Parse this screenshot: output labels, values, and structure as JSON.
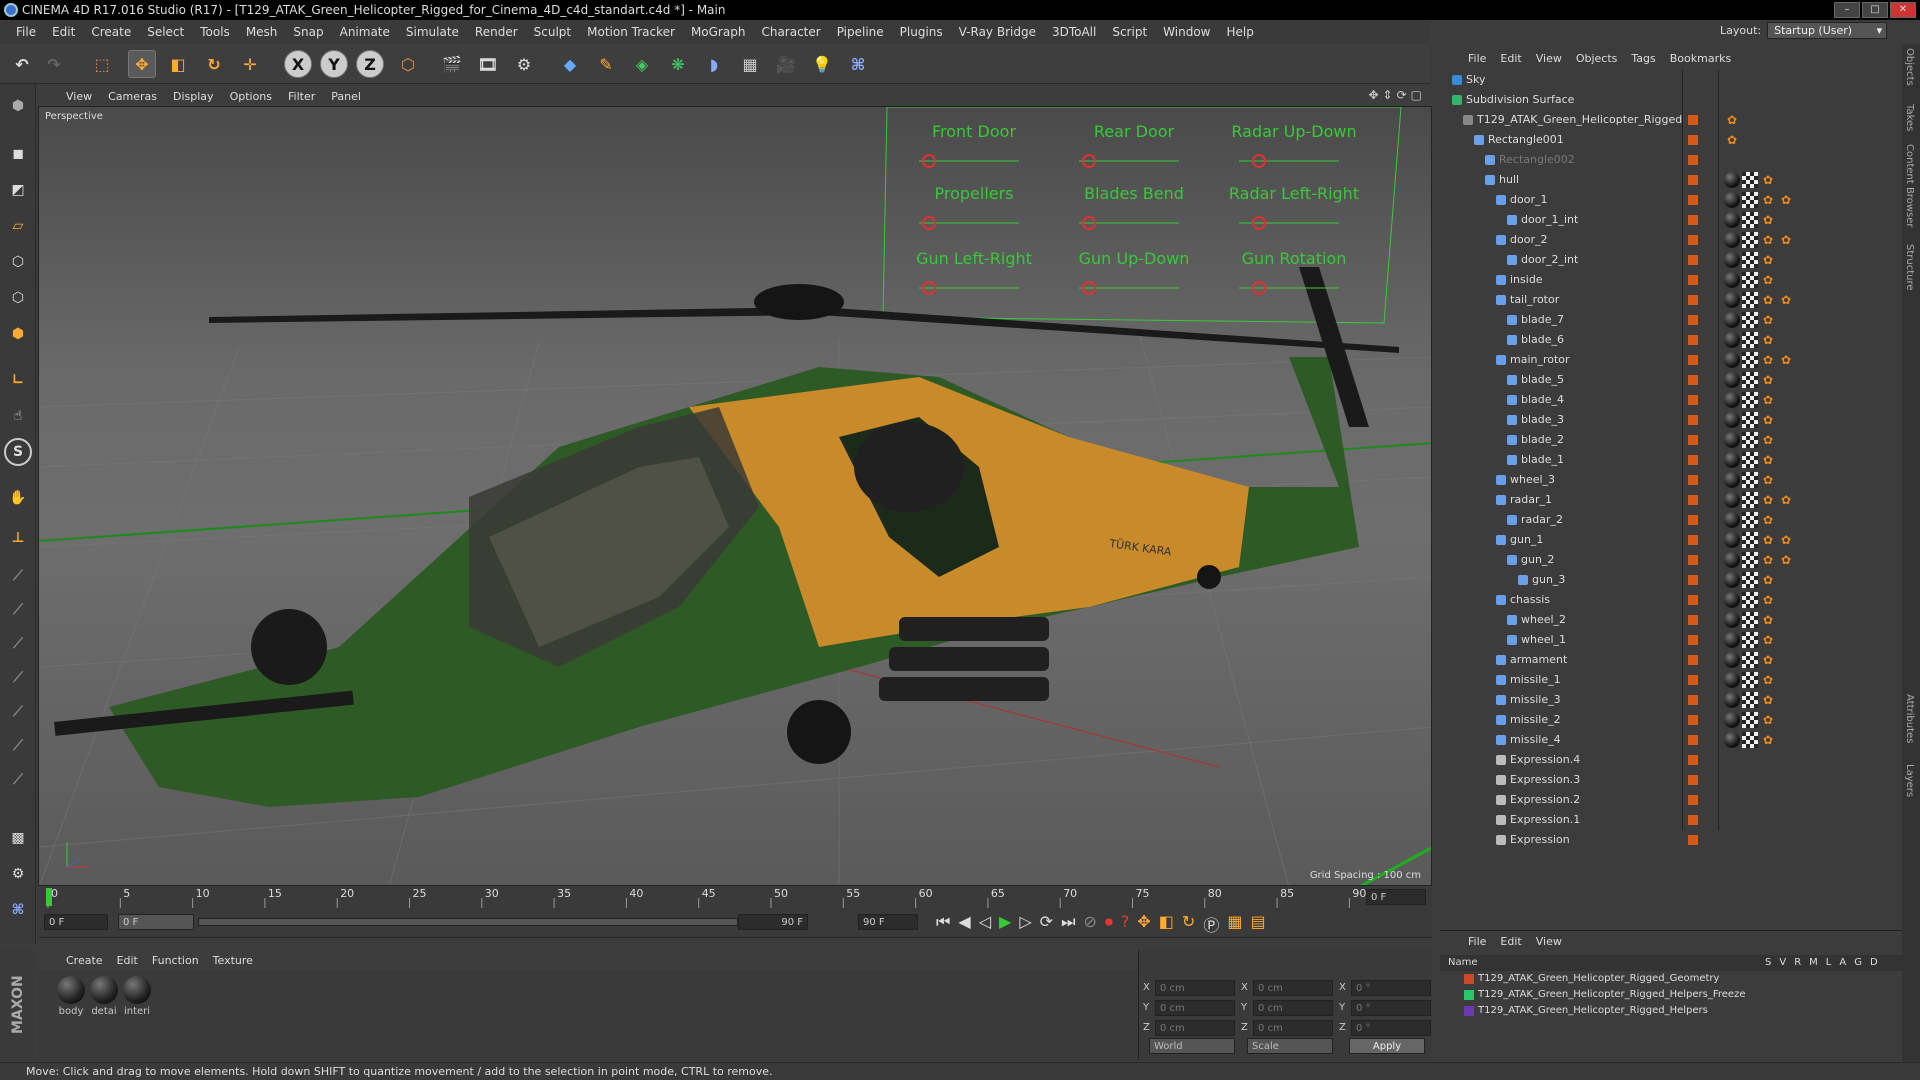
{
  "window": {
    "title": "CINEMA 4D R17.016 Studio (R17) - [T129_ATAK_Green_Helicopter_Rigged_for_Cinema_4D_c4d_standart.c4d *] - Main"
  },
  "menubar": [
    "File",
    "Edit",
    "Create",
    "Select",
    "Tools",
    "Mesh",
    "Snap",
    "Animate",
    "Simulate",
    "Render",
    "Sculpt",
    "Motion Tracker",
    "MoGraph",
    "Character",
    "Pipeline",
    "Plugins",
    "V-Ray Bridge",
    "3DToAll",
    "Script",
    "Window",
    "Help"
  ],
  "layout": {
    "label": "Layout:",
    "value": "Startup (User)"
  },
  "toolbar": {
    "axis_x": "X",
    "axis_y": "Y",
    "axis_z": "Z"
  },
  "viewport": {
    "menu": [
      "View",
      "Cameras",
      "Display",
      "Options",
      "Filter",
      "Panel"
    ],
    "label": "Perspective",
    "grid_spacing": "Grid Spacing : 100 cm",
    "controls": [
      "Front Door",
      "Rear Door",
      "Radar Up-Down",
      "Propellers",
      "Blades Bend",
      "Radar Left-Right",
      "Gun Left-Right",
      "Gun Up-Down",
      "Gun Rotation"
    ],
    "body_text": "TÜRK KARA"
  },
  "timeline": {
    "ticks": [
      "0",
      "5",
      "10",
      "15",
      "20",
      "25",
      "30",
      "35",
      "40",
      "45",
      "50",
      "55",
      "60",
      "65",
      "70",
      "75",
      "80",
      "85",
      "90"
    ],
    "current_frame": "0 F",
    "start_field": "0 F",
    "range_start": "0 F",
    "range_end": "90 F",
    "end_field": "90 F"
  },
  "materials": {
    "menu": [
      "Create",
      "Edit",
      "Function",
      "Texture"
    ],
    "items": [
      "body",
      "detai",
      "interi"
    ]
  },
  "coords": {
    "rows": [
      {
        "a": "X",
        "av": "0 cm",
        "b": "X",
        "bv": "0 cm",
        "c": "X",
        "cv": "0 °"
      },
      {
        "a": "Y",
        "av": "0 cm",
        "b": "Y",
        "bv": "0 cm",
        "c": "Y",
        "cv": "0 °"
      },
      {
        "a": "Z",
        "av": "0 cm",
        "b": "Z",
        "bv": "0 cm",
        "c": "Z",
        "cv": "0 °"
      }
    ],
    "mode": "World",
    "scale": "Scale",
    "apply": "Apply"
  },
  "objects": {
    "menu": [
      "File",
      "Edit",
      "View",
      "Objects",
      "Tags",
      "Bookmarks"
    ],
    "items": [
      {
        "name": "Sky",
        "indent": 0,
        "icon": "#3a8ad8",
        "tags": ""
      },
      {
        "name": "Subdivision Surface",
        "indent": 0,
        "icon": "#3ab06a",
        "tags": ""
      },
      {
        "name": "T129_ATAK_Green_Helicopter_Rigged",
        "indent": 1,
        "icon": "#888",
        "tags": "o"
      },
      {
        "name": "Rectangle001",
        "indent": 2,
        "icon": "#6aa0e8",
        "tags": "o"
      },
      {
        "name": "Rectangle002",
        "indent": 3,
        "icon": "#6aa0e8",
        "tags": ""
      },
      {
        "name": "hull",
        "indent": 3,
        "icon": "#6aa0e8",
        "tags": "bco"
      },
      {
        "name": "door_1",
        "indent": 4,
        "icon": "#6aa0e8",
        "tags": "bcoo"
      },
      {
        "name": "door_1_int",
        "indent": 5,
        "icon": "#6aa0e8",
        "tags": "bco"
      },
      {
        "name": "door_2",
        "indent": 4,
        "icon": "#6aa0e8",
        "tags": "bcoo"
      },
      {
        "name": "door_2_int",
        "indent": 5,
        "icon": "#6aa0e8",
        "tags": "bco"
      },
      {
        "name": "inside",
        "indent": 4,
        "icon": "#6aa0e8",
        "tags": "bco"
      },
      {
        "name": "tail_rotor",
        "indent": 4,
        "icon": "#6aa0e8",
        "tags": "bcoo"
      },
      {
        "name": "blade_7",
        "indent": 5,
        "icon": "#6aa0e8",
        "tags": "bco"
      },
      {
        "name": "blade_6",
        "indent": 5,
        "icon": "#6aa0e8",
        "tags": "bco"
      },
      {
        "name": "main_rotor",
        "indent": 4,
        "icon": "#6aa0e8",
        "tags": "bcoo"
      },
      {
        "name": "blade_5",
        "indent": 5,
        "icon": "#6aa0e8",
        "tags": "bco"
      },
      {
        "name": "blade_4",
        "indent": 5,
        "icon": "#6aa0e8",
        "tags": "bco"
      },
      {
        "name": "blade_3",
        "indent": 5,
        "icon": "#6aa0e8",
        "tags": "bco"
      },
      {
        "name": "blade_2",
        "indent": 5,
        "icon": "#6aa0e8",
        "tags": "bco"
      },
      {
        "name": "blade_1",
        "indent": 5,
        "icon": "#6aa0e8",
        "tags": "bco"
      },
      {
        "name": "wheel_3",
        "indent": 4,
        "icon": "#6aa0e8",
        "tags": "bco"
      },
      {
        "name": "radar_1",
        "indent": 4,
        "icon": "#6aa0e8",
        "tags": "bcoo"
      },
      {
        "name": "radar_2",
        "indent": 5,
        "icon": "#6aa0e8",
        "tags": "bco"
      },
      {
        "name": "gun_1",
        "indent": 4,
        "icon": "#6aa0e8",
        "tags": "bcoo"
      },
      {
        "name": "gun_2",
        "indent": 5,
        "icon": "#6aa0e8",
        "tags": "bcoo"
      },
      {
        "name": "gun_3",
        "indent": 6,
        "icon": "#6aa0e8",
        "tags": "bco"
      },
      {
        "name": "chassis",
        "indent": 4,
        "icon": "#6aa0e8",
        "tags": "bco"
      },
      {
        "name": "wheel_2",
        "indent": 5,
        "icon": "#6aa0e8",
        "tags": "bco"
      },
      {
        "name": "wheel_1",
        "indent": 5,
        "icon": "#6aa0e8",
        "tags": "bco"
      },
      {
        "name": "armament",
        "indent": 4,
        "icon": "#6aa0e8",
        "tags": "bco"
      },
      {
        "name": "missile_1",
        "indent": 4,
        "icon": "#6aa0e8",
        "tags": "bco"
      },
      {
        "name": "missile_3",
        "indent": 4,
        "icon": "#6aa0e8",
        "tags": "bco"
      },
      {
        "name": "missile_2",
        "indent": 4,
        "icon": "#6aa0e8",
        "tags": "bco"
      },
      {
        "name": "missile_4",
        "indent": 4,
        "icon": "#6aa0e8",
        "tags": "bco"
      },
      {
        "name": "Expression.4",
        "indent": 4,
        "icon": "#bbb",
        "tags": ""
      },
      {
        "name": "Expression.3",
        "indent": 4,
        "icon": "#bbb",
        "tags": ""
      },
      {
        "name": "Expression.2",
        "indent": 4,
        "icon": "#bbb",
        "tags": ""
      },
      {
        "name": "Expression.1",
        "indent": 4,
        "icon": "#bbb",
        "tags": ""
      },
      {
        "name": "Expression",
        "indent": 4,
        "icon": "#bbb",
        "tags": ""
      }
    ]
  },
  "layers": {
    "menu": [
      "File",
      "Edit",
      "View"
    ],
    "header": {
      "name": "Name",
      "cols": [
        "S",
        "V",
        "R",
        "M",
        "L",
        "A",
        "G",
        "D"
      ]
    },
    "items": [
      {
        "name": "T129_ATAK_Green_Helicopter_Rigged_Geometry",
        "color": "#c84a2a"
      },
      {
        "name": "T129_ATAK_Green_Helicopter_Rigged_Helpers_Freeze",
        "color": "#2ac86a"
      },
      {
        "name": "T129_ATAK_Green_Helicopter_Rigged_Helpers",
        "color": "#6a3ab0"
      }
    ]
  },
  "side_tabs": [
    "Objects",
    "Takes",
    "Content Browser",
    "Structure",
    "Attributes",
    "Layers"
  ],
  "status": "Move: Click and drag to move elements. Hold down SHIFT to quantize movement / add to the selection in point mode, CTRL to remove.",
  "brand": "MAXON CINEMA 4D"
}
